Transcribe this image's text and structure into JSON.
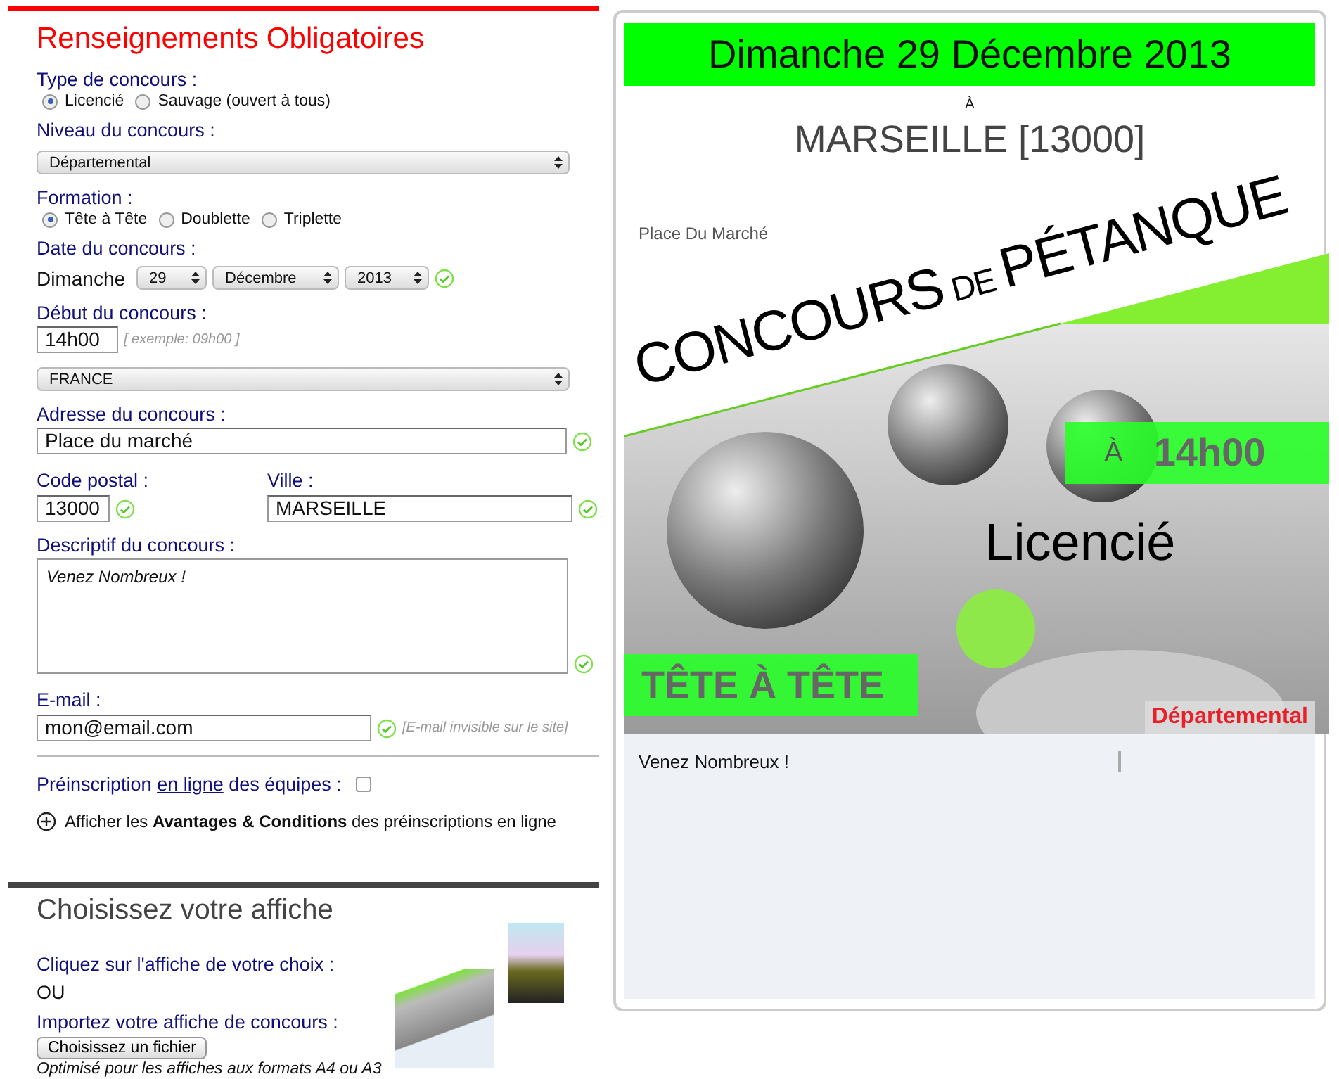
{
  "form": {
    "heading": "Renseignements Obligatoires",
    "type": {
      "label": "Type de concours :",
      "options": [
        {
          "label": "Licencié",
          "selected": true
        },
        {
          "label": "Sauvage (ouvert à tous)",
          "selected": false
        }
      ]
    },
    "level": {
      "label": "Niveau du concours :",
      "value": "Départemental"
    },
    "formation": {
      "label": "Formation :",
      "options": [
        {
          "label": "Tête à Tête",
          "selected": true
        },
        {
          "label": "Doublette",
          "selected": false
        },
        {
          "label": "Triplette",
          "selected": false
        }
      ]
    },
    "date": {
      "label": "Date du concours :",
      "weekday": "Dimanche",
      "day": "29",
      "month": "Décembre",
      "year": "2013",
      "valid": true
    },
    "start": {
      "label": "Début du concours :",
      "value": "14h00",
      "hint": "[ exemple: 09h00 ]"
    },
    "country": {
      "value": "FRANCE"
    },
    "address": {
      "label": "Adresse du concours :",
      "value": "Place du marché",
      "valid": true
    },
    "postcode": {
      "label": "Code postal :",
      "value": "13000",
      "valid": true
    },
    "city": {
      "label": "Ville :",
      "value": "MARSEILLE",
      "valid": true
    },
    "description": {
      "label": "Descriptif du concours :",
      "value": "Venez Nombreux !",
      "valid": true
    },
    "email": {
      "label": "E-mail :",
      "value": "mon@email.com",
      "valid": true,
      "hint": "[E-mail invisible sur le site]"
    },
    "preregistration": {
      "label_before": "Préinscription",
      "link": "en ligne",
      "label_after": "des équipes :",
      "checked": false
    },
    "conditions": {
      "text": "Afficher les **Avantages & Conditions** des préinscriptions en ligne"
    }
  },
  "poster_chooser": {
    "heading": "Choisissez votre affiche",
    "click_hint": "Cliquez sur l'affiche de votre choix :",
    "or": "OU",
    "import_label": "Importez votre affiche de concours :",
    "file_button": "Choisissez un fichier",
    "note": "Optimisé pour les affiches aux formats A4 ou A3"
  },
  "preview": {
    "date": "Dimanche 29 Décembre 2013",
    "at": "À",
    "city": "MARSEILLE [13000]",
    "address": "Place Du Marché",
    "banner_words": [
      {
        "text": "CONCOURS",
        "kind": "main"
      },
      {
        "text": "DE",
        "kind": "minor"
      },
      {
        "text": "PÉTANQUE",
        "kind": "main"
      }
    ],
    "time_prefix": "À",
    "time": "14h00",
    "type": "Licencié",
    "formation": "TÊTE À TÊTE",
    "level": "Départemental",
    "description": "Venez Nombreux !"
  }
}
